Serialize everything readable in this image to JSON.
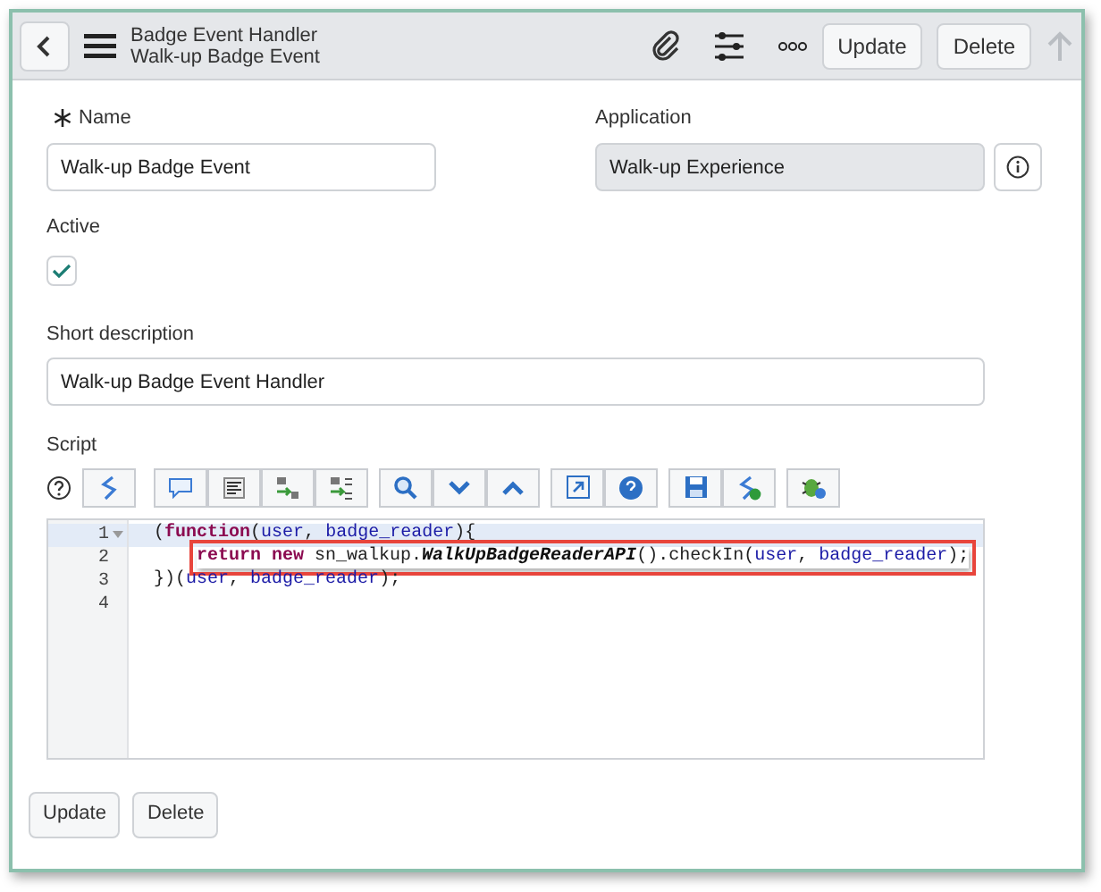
{
  "header": {
    "title": "Badge Event Handler",
    "subtitle": "Walk-up Badge Event",
    "buttons": [
      "Update",
      "Delete"
    ]
  },
  "fields": {
    "name": {
      "label": "Name",
      "required": true,
      "value": "Walk-up Badge Event"
    },
    "application": {
      "label": "Application",
      "value": "Walk-up Experience",
      "disabled": true
    },
    "active": {
      "label": "Active",
      "checked": true
    },
    "short_description": {
      "label": "Short description",
      "value": "Walk-up Badge Event Handler"
    }
  },
  "script": {
    "label": "Script",
    "lines": [
      {
        "number": "1",
        "fold": true,
        "current": true,
        "marked": false,
        "tokens": [
          {
            "kind": "plain",
            "text": "("
          },
          {
            "kind": "keyword",
            "text": "function"
          },
          {
            "kind": "plain",
            "text": "("
          },
          {
            "kind": "var",
            "text": "user"
          },
          {
            "kind": "plain",
            "text": ", "
          },
          {
            "kind": "var",
            "text": "badge_reader"
          },
          {
            "kind": "plain",
            "text": "){"
          }
        ]
      },
      {
        "number": "2",
        "fold": false,
        "current": false,
        "marked": true,
        "indented": true,
        "tokens": [
          {
            "kind": "keyword",
            "text": "return new"
          },
          {
            "kind": "plain",
            "text": " sn_walkup."
          },
          {
            "kind": "class",
            "text": "WalkUpBadgeReaderAPI"
          },
          {
            "kind": "plain",
            "text": "().checkIn("
          },
          {
            "kind": "var",
            "text": "user"
          },
          {
            "kind": "plain",
            "text": ", "
          },
          {
            "kind": "var",
            "text": "badge_reader"
          },
          {
            "kind": "plain",
            "text": ");"
          }
        ]
      },
      {
        "number": "3",
        "fold": false,
        "current": false,
        "marked": false,
        "tokens": [
          {
            "kind": "plain",
            "text": "})("
          },
          {
            "kind": "var",
            "text": "user"
          },
          {
            "kind": "plain",
            "text": ", "
          },
          {
            "kind": "var",
            "text": "badge_reader"
          },
          {
            "kind": "plain",
            "text": ");"
          }
        ]
      },
      {
        "number": "4",
        "fold": false,
        "current": false,
        "marked": false
      }
    ]
  },
  "footer_buttons": [
    "Update",
    "Delete"
  ]
}
